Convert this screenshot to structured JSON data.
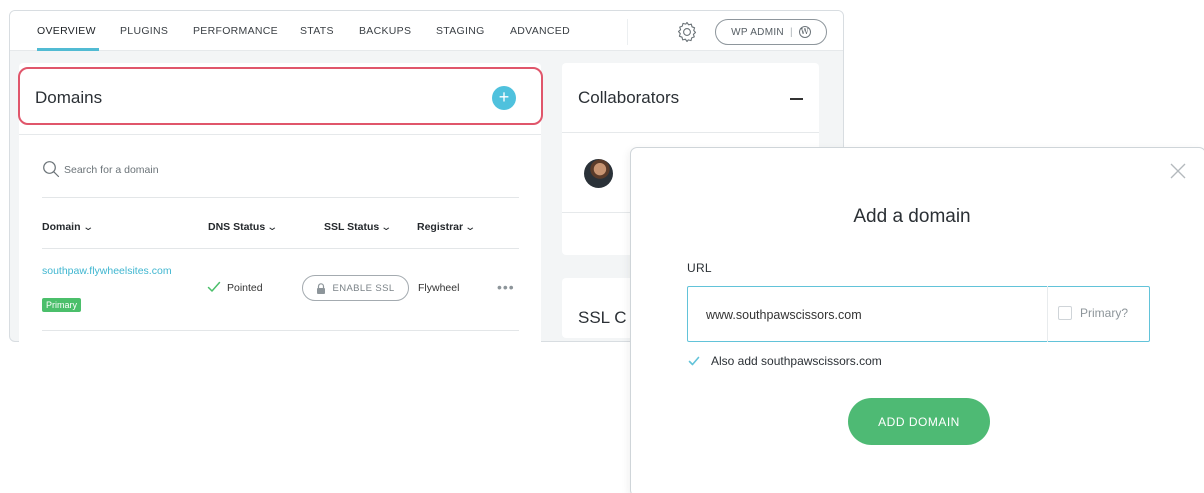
{
  "nav": {
    "tabs": [
      "OVERVIEW",
      "PLUGINS",
      "PERFORMANCE",
      "STATS",
      "BACKUPS",
      "STAGING",
      "ADVANCED"
    ],
    "active_tab": "OVERVIEW",
    "settings_icon": "gear-icon",
    "wp_admin_label": "WP ADMIN",
    "wp_separator": "|",
    "wp_logo": "W"
  },
  "domains": {
    "title": "Domains",
    "add_icon": "+",
    "search_placeholder": "Search for a domain",
    "columns": [
      "Domain",
      "DNS Status",
      "SSL Status",
      "Registrar"
    ],
    "column_chevron": "⌄",
    "rows": [
      {
        "domain": "southpaw.flywheelsites.com",
        "badge": "Primary",
        "dns_status": "Pointed",
        "ssl_action": "ENABLE SSL",
        "registrar": "Flywheel",
        "more": "•••"
      }
    ]
  },
  "collaborators": {
    "title": "Collaborators",
    "collapse_icon": "minus-icon"
  },
  "ssl_card": {
    "title": "SSL C"
  },
  "modal": {
    "title": "Add a domain",
    "url_label": "URL",
    "url_value": "www.southpawscissors.com",
    "primary_label": "Primary?",
    "primary_checked": false,
    "also_add_label": "Also add southpawscissors.com",
    "also_add_checked": true,
    "submit_label": "ADD DOMAIN",
    "close_icon": "close-icon"
  },
  "colors": {
    "accent": "#51bbd3",
    "highlight": "#e0566b",
    "success": "#4eba74",
    "link": "#3fb6d0"
  }
}
